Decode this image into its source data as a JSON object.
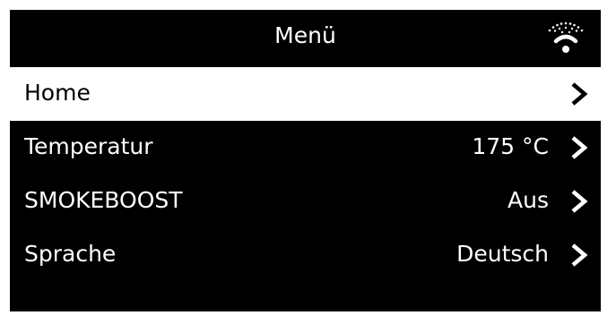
{
  "header": {
    "title": "Menü",
    "icon": "wifi-icon"
  },
  "menu": {
    "items": [
      {
        "label": "Home",
        "value": "",
        "selected": true
      },
      {
        "label": "Temperatur",
        "value": "175 °C",
        "selected": false
      },
      {
        "label": "SMOKEBOOST",
        "value": "Aus",
        "selected": false
      },
      {
        "label": "Sprache",
        "value": "Deutsch",
        "selected": false
      }
    ]
  },
  "colors": {
    "background": "#000000",
    "foreground": "#ffffff",
    "selected_background": "#ffffff",
    "selected_foreground": "#000000"
  }
}
